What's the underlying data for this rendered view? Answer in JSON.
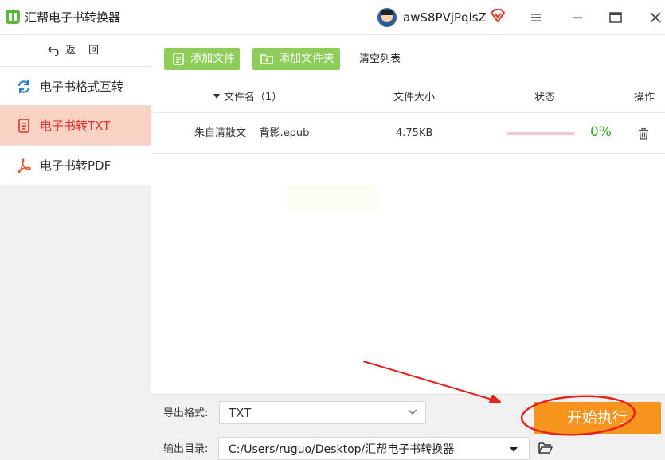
{
  "titlebar": {
    "app_title": "汇帮电子书转换器",
    "username": "awS8PVjPqlsZ",
    "icons": [
      "menu-icon",
      "minimize-icon",
      "maximize-icon",
      "close-icon"
    ]
  },
  "sidebar": {
    "back_label": "返回",
    "items": [
      {
        "label": "电子书格式互转",
        "icon": "refresh-icon",
        "active": false
      },
      {
        "label": "电子书转TXT",
        "icon": "document-icon",
        "active": true
      },
      {
        "label": "电子书转PDF",
        "icon": "pdf-icon",
        "active": false
      }
    ]
  },
  "toolbar": {
    "add_file": "添加文件",
    "add_folder": "添加文件夹",
    "clear_list": "清空列表"
  },
  "table": {
    "headers": {
      "name": "文件名（1）",
      "size": "文件大小",
      "status": "状态",
      "action": "操作"
    },
    "rows": [
      {
        "name": "朱自清散文    背影.epub",
        "size": "4.75KB",
        "progress": 0,
        "percent": "0%"
      }
    ]
  },
  "bottom": {
    "format_label": "导出格式:",
    "format_value": "TXT",
    "outdir_label": "输出目录:",
    "outdir_value": "C:/Users/ruguo/Desktop/汇帮电子书转换器",
    "start_button": "开始执行"
  },
  "colors": {
    "accent_green": "#8dce5a",
    "active_bg": "#f8d2c2",
    "active_text": "#e8322c",
    "start_orange": "#f7941d",
    "progress_pink": "#f5c5cf",
    "percent_green": "#38a81a",
    "annotation_red": "#e8221a"
  }
}
